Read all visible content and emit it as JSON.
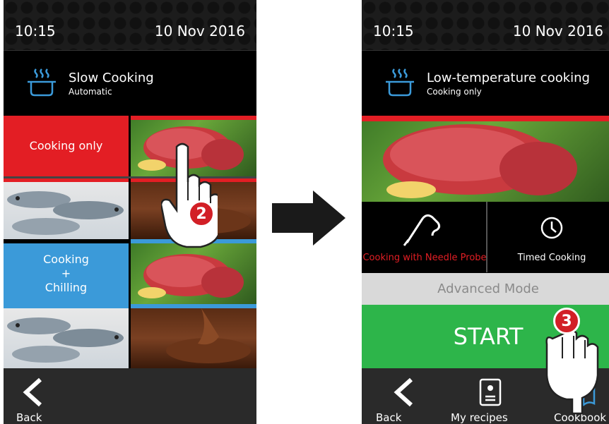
{
  "left_screen": {
    "time": "10:15",
    "date": "10 Nov 2016",
    "mode_title": "Slow Cooking",
    "mode_subtitle": "Automatic",
    "tiles": {
      "cooking_only": "Cooking only",
      "cooking_chilling_line1": "Cooking",
      "cooking_chilling_line2": "+",
      "cooking_chilling_line3": "Chilling"
    },
    "back_label": "Back"
  },
  "right_screen": {
    "time": "10:15",
    "date": "10 Nov 2016",
    "mode_title": "Low-temperature cooking",
    "mode_subtitle": "Cooking only",
    "options": {
      "needle_probe": "Cooking with Needle Probe",
      "timed": "Timed Cooking"
    },
    "advanced_mode": "Advanced Mode",
    "start": "START",
    "nav": {
      "back": "Back",
      "my_recipes": "My recipes",
      "cookbook": "Cookbook"
    }
  },
  "annotations": {
    "step2": "2",
    "step3": "3"
  },
  "colors": {
    "red": "#e31e24",
    "blue": "#3b9ad9",
    "green": "#2db54a",
    "icon_blue": "#3b9ad9",
    "probe_red": "#e31e24"
  }
}
